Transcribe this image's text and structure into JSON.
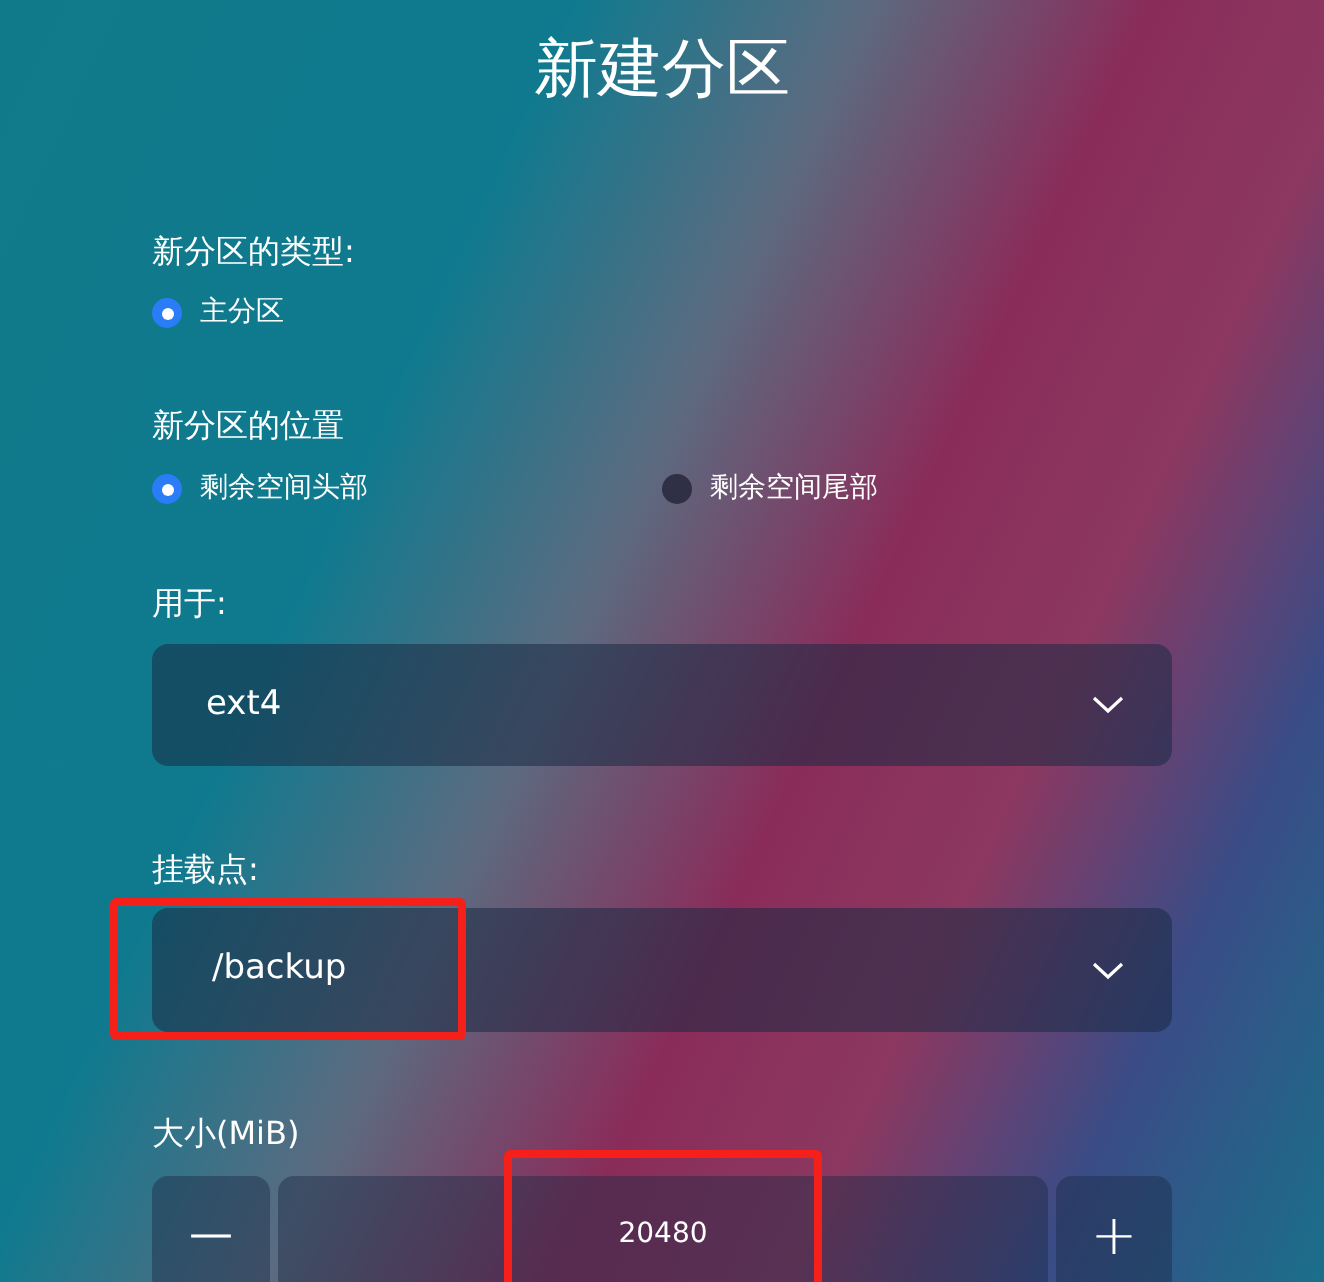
{
  "title": "新建分区",
  "partition_type": {
    "label": "新分区的类型:",
    "options": [
      {
        "label": "主分区",
        "selected": true
      }
    ]
  },
  "partition_location": {
    "label": "新分区的位置",
    "options": [
      {
        "label": "剩余空间头部",
        "selected": true
      },
      {
        "label": "剩余空间尾部",
        "selected": false
      }
    ]
  },
  "use_as": {
    "label": "用于:",
    "value": "ext4"
  },
  "mount_point": {
    "label": "挂载点:",
    "value": "/backup",
    "annotated": true
  },
  "size": {
    "label": "大小(MiB)",
    "value": "20480",
    "decrement": "—",
    "increment": "+",
    "annotated": true
  }
}
